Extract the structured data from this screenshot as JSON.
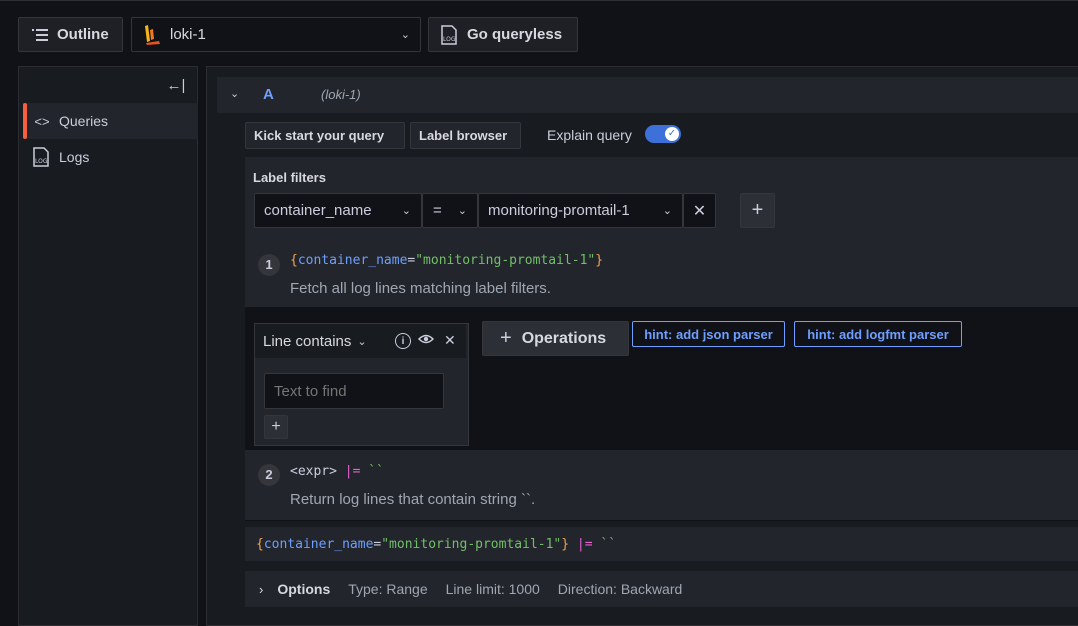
{
  "toolbar": {
    "outline_label": "Outline",
    "datasource_name": "loki-1",
    "queryless_label": "Go queryless",
    "queryless_icon": "LOG"
  },
  "sidebar": {
    "items": [
      {
        "label": "Queries",
        "icon": "code-icon",
        "active": true
      },
      {
        "label": "Logs",
        "icon": "logs-icon",
        "active": false
      }
    ]
  },
  "query": {
    "ref_id": "A",
    "datasource": "(loki-1)",
    "kick_start_label": "Kick start your query",
    "label_browser_label": "Label browser",
    "explain_label": "Explain query",
    "explain_enabled": true,
    "label_filters_title": "Label filters",
    "filter": {
      "label": "container_name",
      "operator": "=",
      "value": "monitoring-promtail-1"
    },
    "steps": [
      {
        "num": "1",
        "code": {
          "open": "{",
          "key": "container_name",
          "eq": "=",
          "value": "\"monitoring-promtail-1\"",
          "close": "}"
        },
        "description": "Fetch all log lines matching label filters."
      },
      {
        "num": "2",
        "code": {
          "expr": "<expr>",
          "op": "|=",
          "str": "``"
        },
        "description": "Return log lines that contain string ``."
      }
    ],
    "operation": {
      "name": "Line contains",
      "placeholder": "Text to find"
    },
    "operations_label": "Operations",
    "hints": [
      "hint: add json parser",
      "hint: add logfmt parser"
    ],
    "raw_query": {
      "open": "{",
      "key": "container_name",
      "eq": "=",
      "value": "\"monitoring-promtail-1\"",
      "close": "}",
      "op": "|=",
      "str": "``"
    },
    "options": {
      "title": "Options",
      "type": "Type: Range",
      "line_limit": "Line limit: 1000",
      "direction": "Direction: Backward"
    }
  },
  "colors": {
    "background": "#111217",
    "panel": "#181b1f",
    "accent": "#3d71d9",
    "active_bar": "#f55f3e",
    "code_brace": "#f2a34d",
    "code_key": "#6e9fff",
    "code_string": "#73bf69",
    "code_op": "#e95fd4"
  }
}
